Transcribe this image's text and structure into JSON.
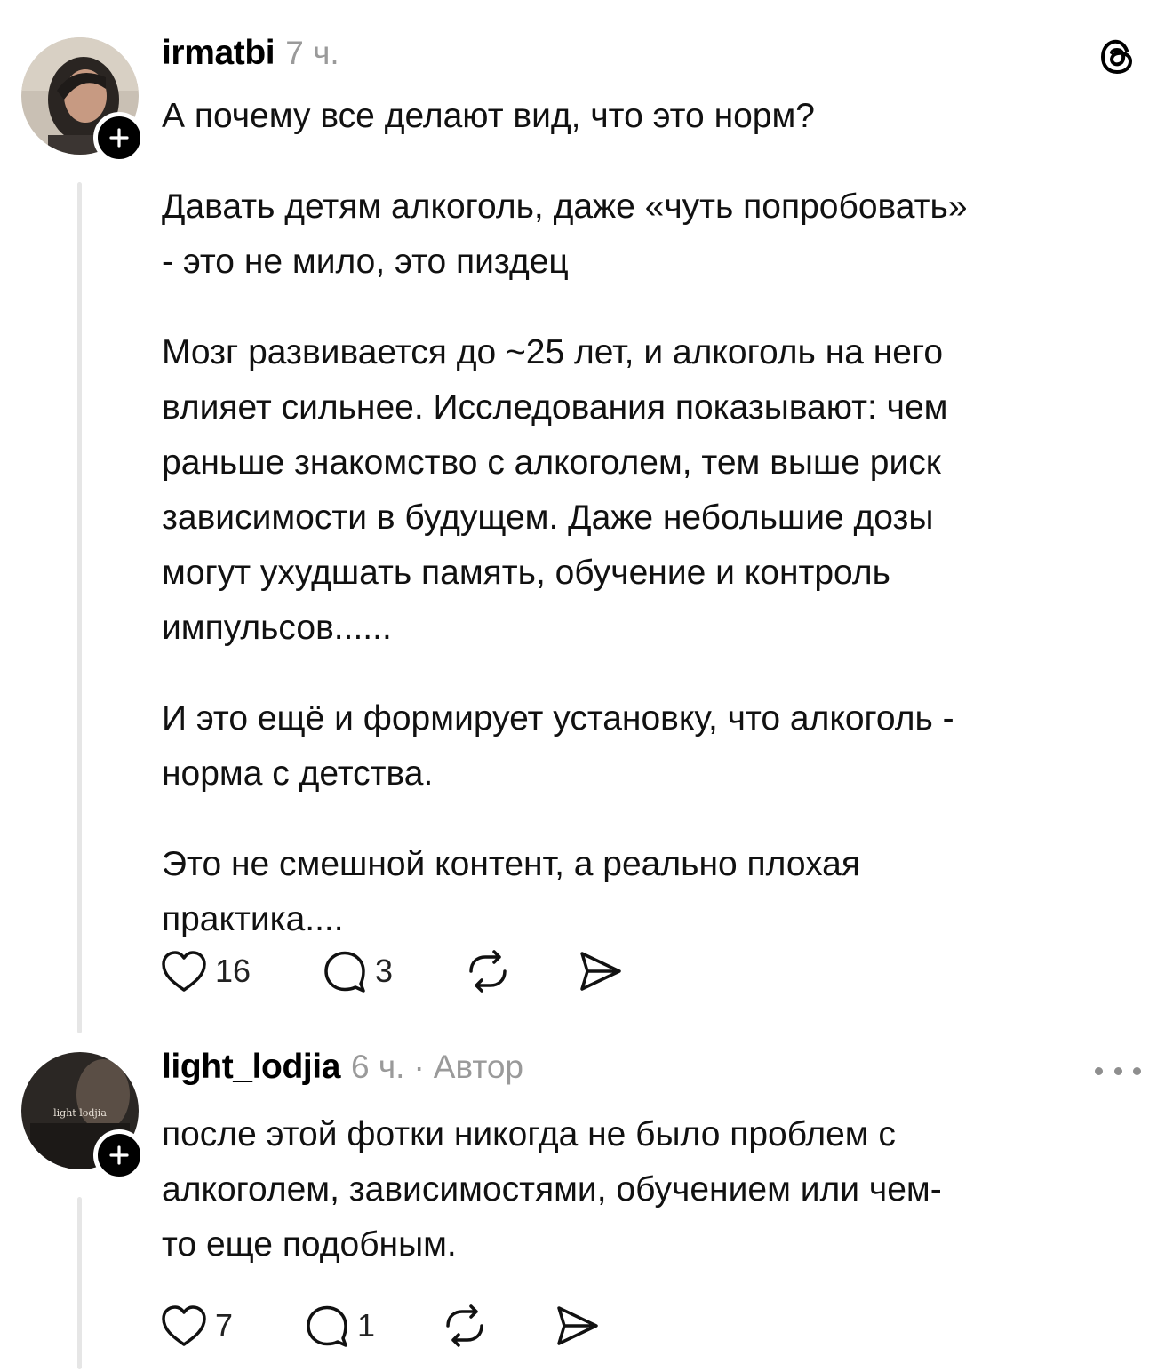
{
  "posts": [
    {
      "username": "irmatbi",
      "time": "7 ч.",
      "paragraphs": [
        "А почему все делают вид, что это норм?",
        "Давать детям алкоголь, даже «чуть попробовать»\n- это не мило, это пиздец",
        "Мозг развивается до ~25 лет, и алкоголь на него\nвлияет сильнее. Исследования показывают: чем\nраньше знакомство с алкоголем, тем выше риск\nзависимости в будущем. Даже небольшие дозы\nмогут ухудшать память, обучение и контроль\nимпульсов......",
        "И это ещё и формирует установку, что алкоголь -\nнорма с детства.",
        "Это не смешной контент, а реально плохая\nпрактика...."
      ],
      "likes": "16",
      "replies": "3",
      "icons": [
        "avatar",
        "plus-icon",
        "threads-logo-icon",
        "heart-icon",
        "comment-icon",
        "repost-icon",
        "share-icon"
      ]
    },
    {
      "username": "light_lodjia",
      "time": "6 ч.",
      "separator": "·",
      "author_tag": "Автор",
      "avatar_text": "light lodjia",
      "paragraphs": [
        "после этой фотки никогда не было проблем с\nалкоголем, зависимостями, обучением или чем-\nто еще подобным."
      ],
      "likes": "7",
      "replies": "1",
      "icons": [
        "avatar",
        "plus-icon",
        "more-icon",
        "heart-icon",
        "comment-icon",
        "repost-icon",
        "share-icon"
      ]
    }
  ],
  "colors": {
    "text": "#111111",
    "muted": "#9a9a9a",
    "thread_line": "#e6e6e6",
    "follow_button": "#000000"
  }
}
